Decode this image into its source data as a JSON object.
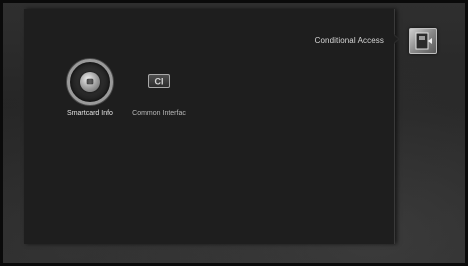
{
  "menu": {
    "title": "Conditional Access",
    "category_icon": "conditional-access-icon",
    "items": [
      {
        "label": "Smartcard Info",
        "icon": "smartcard-icon",
        "selected": true
      },
      {
        "label": "Common Interfac",
        "icon": "common-interface-icon",
        "selected": false
      }
    ]
  },
  "colors": {
    "background": "#262626",
    "panel": "#1e1e1e",
    "text": "#e4e4e4",
    "accent_silver": "#9a9a9a"
  }
}
